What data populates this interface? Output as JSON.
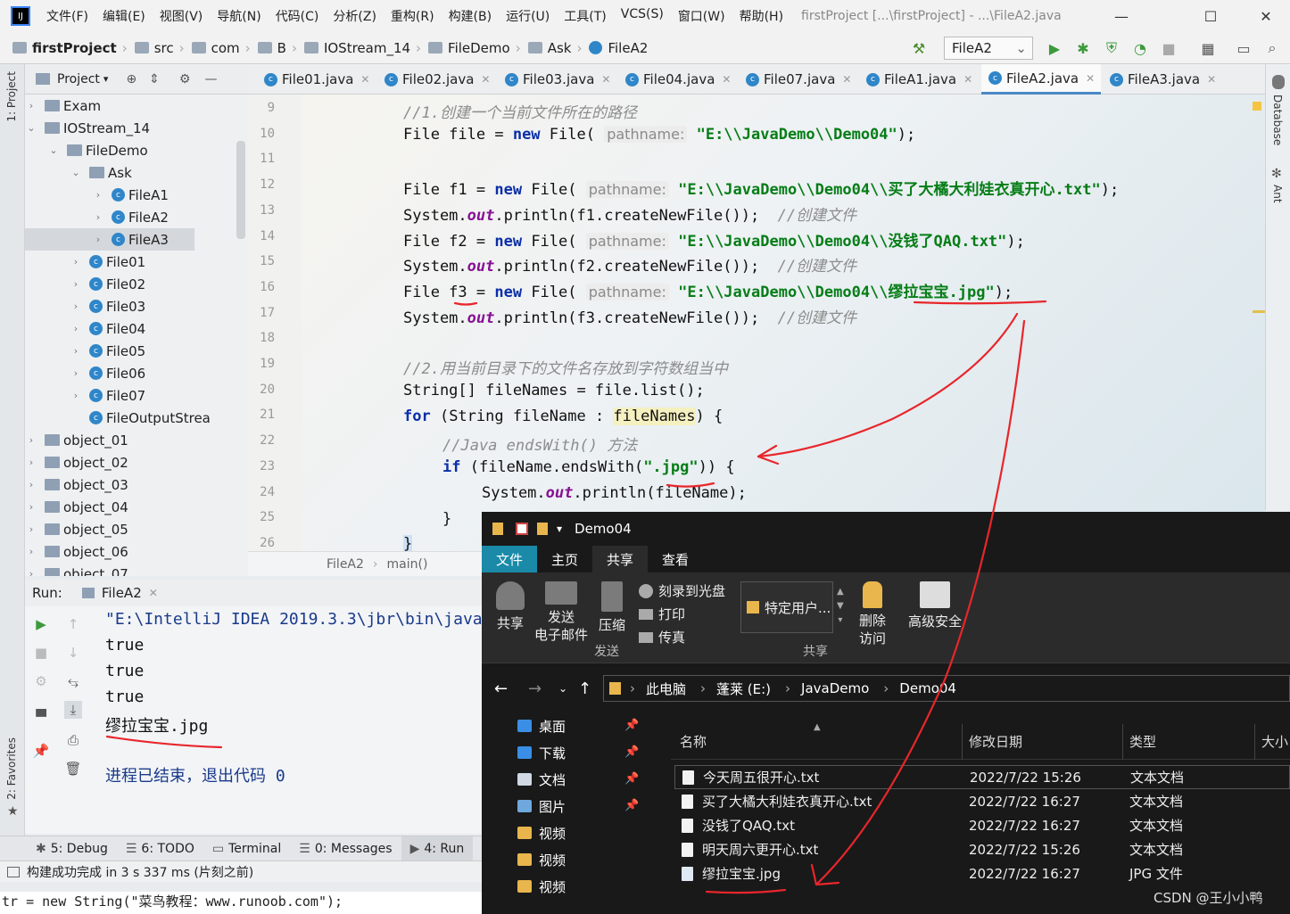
{
  "menubar": {
    "items": [
      "文件(F)",
      "编辑(E)",
      "视图(V)",
      "导航(N)",
      "代码(C)",
      "分析(Z)",
      "重构(R)",
      "构建(B)",
      "运行(U)",
      "工具(T)",
      "VCS(S)",
      "窗口(W)",
      "帮助(H)"
    ],
    "title": "firstProject [...\\firstProject] - ...\\FileA2.java"
  },
  "breadcrumb": [
    "firstProject",
    "src",
    "com",
    "B",
    "IOStream_14",
    "FileDemo",
    "Ask",
    "FileA2"
  ],
  "run_config": "FileA2",
  "left_strip": {
    "project": "1: Project",
    "favorites": "2: Favorites"
  },
  "right_strip": {
    "database": "Database",
    "ant": "Ant"
  },
  "project_panel": {
    "title": "Project"
  },
  "tree": [
    {
      "label": "Exam",
      "type": "folder",
      "depth": 0,
      "open": false
    },
    {
      "label": "IOStream_14",
      "type": "folder",
      "depth": 0,
      "open": true
    },
    {
      "label": "FileDemo",
      "type": "folder",
      "depth": 1,
      "open": true
    },
    {
      "label": "Ask",
      "type": "folder",
      "depth": 2,
      "open": true
    },
    {
      "label": "FileA1",
      "type": "class",
      "depth": 3
    },
    {
      "label": "FileA2",
      "type": "class",
      "depth": 3
    },
    {
      "label": "FileA3",
      "type": "class",
      "depth": 3,
      "selected": true
    },
    {
      "label": "File01",
      "type": "class",
      "depth": 2
    },
    {
      "label": "File02",
      "type": "class",
      "depth": 2
    },
    {
      "label": "File03",
      "type": "class",
      "depth": 2
    },
    {
      "label": "File04",
      "type": "class",
      "depth": 2
    },
    {
      "label": "File05",
      "type": "class",
      "depth": 2
    },
    {
      "label": "File06",
      "type": "class",
      "depth": 2
    },
    {
      "label": "File07",
      "type": "class",
      "depth": 2
    },
    {
      "label": "FileOutputStrea",
      "type": "class",
      "depth": 2,
      "leaf": true
    },
    {
      "label": "object_01",
      "type": "folder",
      "depth": 0
    },
    {
      "label": "object_02",
      "type": "folder",
      "depth": 0
    },
    {
      "label": "object_03",
      "type": "folder",
      "depth": 0
    },
    {
      "label": "object_04",
      "type": "folder",
      "depth": 0
    },
    {
      "label": "object_05",
      "type": "folder",
      "depth": 0
    },
    {
      "label": "object_06",
      "type": "folder",
      "depth": 0
    },
    {
      "label": "object_07",
      "type": "folder",
      "depth": 0
    }
  ],
  "tabs": [
    "File01.java",
    "File02.java",
    "File03.java",
    "File04.java",
    "File07.java",
    "FileA1.java",
    "FileA2.java",
    "FileA3.java"
  ],
  "active_tab": "FileA2.java",
  "line_numbers": [
    "9",
    "10",
    "11",
    "12",
    "13",
    "14",
    "15",
    "16",
    "17",
    "18",
    "19",
    "20",
    "21",
    "22",
    "23",
    "24",
    "25",
    "26"
  ],
  "code": {
    "l9_comment": "//1.创建一个当前文件所在的路径",
    "l10_pre": "File file = ",
    "l10_kw": "new",
    "l10_mid": " File( ",
    "l10_hint": "pathname:",
    "l10_str": "\"E:\\\\JavaDemo\\\\Demo04\"",
    "l10_end": ");",
    "l12_pre": "File f1 = ",
    "l12_kw": "new",
    "l12_mid": " File( ",
    "l12_hint": "pathname:",
    "l12_str": "\"E:\\\\JavaDemo\\\\Demo04\\\\买了大橘大利娃衣真开心.txt\"",
    "l12_end": ");",
    "l13_pre": "System.",
    "l13_fld": "out",
    "l13_mid": ".println(f1.createNewFile());  ",
    "l13_cm": "//创建文件",
    "l14_pre": "File f2 = ",
    "l14_kw": "new",
    "l14_mid": " File( ",
    "l14_hint": "pathname:",
    "l14_str": "\"E:\\\\JavaDemo\\\\Demo04\\\\没钱了QAQ.txt\"",
    "l14_end": ");",
    "l15_pre": "System.",
    "l15_fld": "out",
    "l15_mid": ".println(f2.createNewFile());  ",
    "l15_cm": "//创建文件",
    "l16_pre": "File f3 = ",
    "l16_kw": "new",
    "l16_mid": " File( ",
    "l16_hint": "pathname:",
    "l16_str": "\"E:\\\\JavaDemo\\\\Demo04\\\\缪拉宝宝.jpg\"",
    "l16_end": ");",
    "l17_pre": "System.",
    "l17_fld": "out",
    "l17_mid": ".println(f3.createNewFile());  ",
    "l17_cm": "//创建文件",
    "l19_comment": "//2.用当前目录下的文件名存放到字符数组当中",
    "l20": "String[] fileNames = file.list();",
    "l21_kw": "for",
    "l21_pre": " (String fileName : ",
    "l21_hl": "fileNames",
    "l21_end": ") {",
    "l22_comment": "//Java endsWith() 方法",
    "l23_kw": "if",
    "l23_pre": " (fileName.endsWith(",
    "l23_str": "\".jpg\"",
    "l23_end": ")) {",
    "l24_pre": "System.",
    "l24_fld": "out",
    "l24_end": ".println(fileName);",
    "l25": "}",
    "l26": "}"
  },
  "editor_breadcrumb": {
    "cls": "FileA2",
    "method": "main()"
  },
  "run": {
    "label": "Run:",
    "tab": "FileA2",
    "cmd": "\"E:\\IntelliJ IDEA 2019.3.3\\jbr\\bin\\java",
    "lines": [
      "true",
      "true",
      "true",
      "缪拉宝宝.jpg"
    ],
    "exit": "进程已结束，退出代码 0"
  },
  "bottom_tools": [
    "5: Debug",
    "6: TODO",
    "Terminal",
    "0: Messages",
    "4: Run"
  ],
  "status": "构建成功完成 in 3 s 337 ms (片刻之前)",
  "tail_code": "tr = new String(\"菜鸟教程：www.runoob.com\");",
  "explorer": {
    "title": "Demo04",
    "ribbon_tabs": [
      "文件",
      "主页",
      "共享",
      "查看"
    ],
    "active_ribbon": "共享",
    "share_btn": "共享",
    "email_btn": "发送\n电子邮件",
    "zip_btn": "压缩",
    "burn": "刻录到光盘",
    "print": "打印",
    "fax": "传真",
    "user_combo": "特定用户...",
    "remove_access": "删除\n访问",
    "advanced_security": "高级安全",
    "group_send": "发送",
    "group_share": "共享",
    "path": [
      "此电脑",
      "蓬莱 (E:)",
      "JavaDemo",
      "Demo04"
    ],
    "nav": [
      {
        "label": "桌面",
        "color": "#3a8ee6",
        "pinned": true
      },
      {
        "label": "下载",
        "color": "#3a8ee6",
        "pinned": true
      },
      {
        "label": "文档",
        "color": "#cfd8e3",
        "pinned": true
      },
      {
        "label": "图片",
        "color": "#6fa8dc",
        "pinned": true
      },
      {
        "label": "视频",
        "color": "#e8b64c",
        "pinned": false
      },
      {
        "label": "视频",
        "color": "#e8b64c",
        "pinned": false
      },
      {
        "label": "视频",
        "color": "#e8b64c",
        "pinned": false
      }
    ],
    "columns": [
      "名称",
      "修改日期",
      "类型",
      "大小"
    ],
    "files": [
      {
        "name": "今天周五很开心.txt",
        "date": "2022/7/22 15:26",
        "type": "文本文档"
      },
      {
        "name": "买了大橘大利娃衣真开心.txt",
        "date": "2022/7/22 16:27",
        "type": "文本文档"
      },
      {
        "name": "没钱了QAQ.txt",
        "date": "2022/7/22 16:27",
        "type": "文本文档"
      },
      {
        "name": "明天周六更开心.txt",
        "date": "2022/7/22 15:26",
        "type": "文本文档"
      },
      {
        "name": "缪拉宝宝.jpg",
        "date": "2022/7/22 16:27",
        "type": "JPG 文件"
      }
    ]
  },
  "watermark": "CSDN @王小小鸭"
}
